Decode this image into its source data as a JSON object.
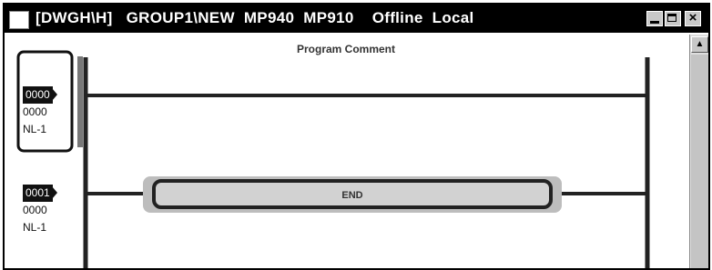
{
  "window": {
    "title": "[DWGH\\H]   GROUP1\\NEW  MP940  MP910    Offline  Local"
  },
  "header": {
    "program_comment": "Program Comment"
  },
  "rungs": [
    {
      "number": "0000",
      "step": "0000",
      "network": "NL-1",
      "selected": true
    },
    {
      "number": "0001",
      "step": "0000",
      "network": "NL-1",
      "selected": false
    }
  ],
  "end_instruction": {
    "label": "END"
  },
  "colors": {
    "titlebar": "#000000",
    "rail": "#222222",
    "end_fill": "#c8c8c8",
    "end_shadow": "#bdbdbd"
  },
  "icons": [
    "window-menu-icon",
    "minimize-icon",
    "maximize-icon",
    "close-icon",
    "scroll-up-arrow-icon"
  ]
}
